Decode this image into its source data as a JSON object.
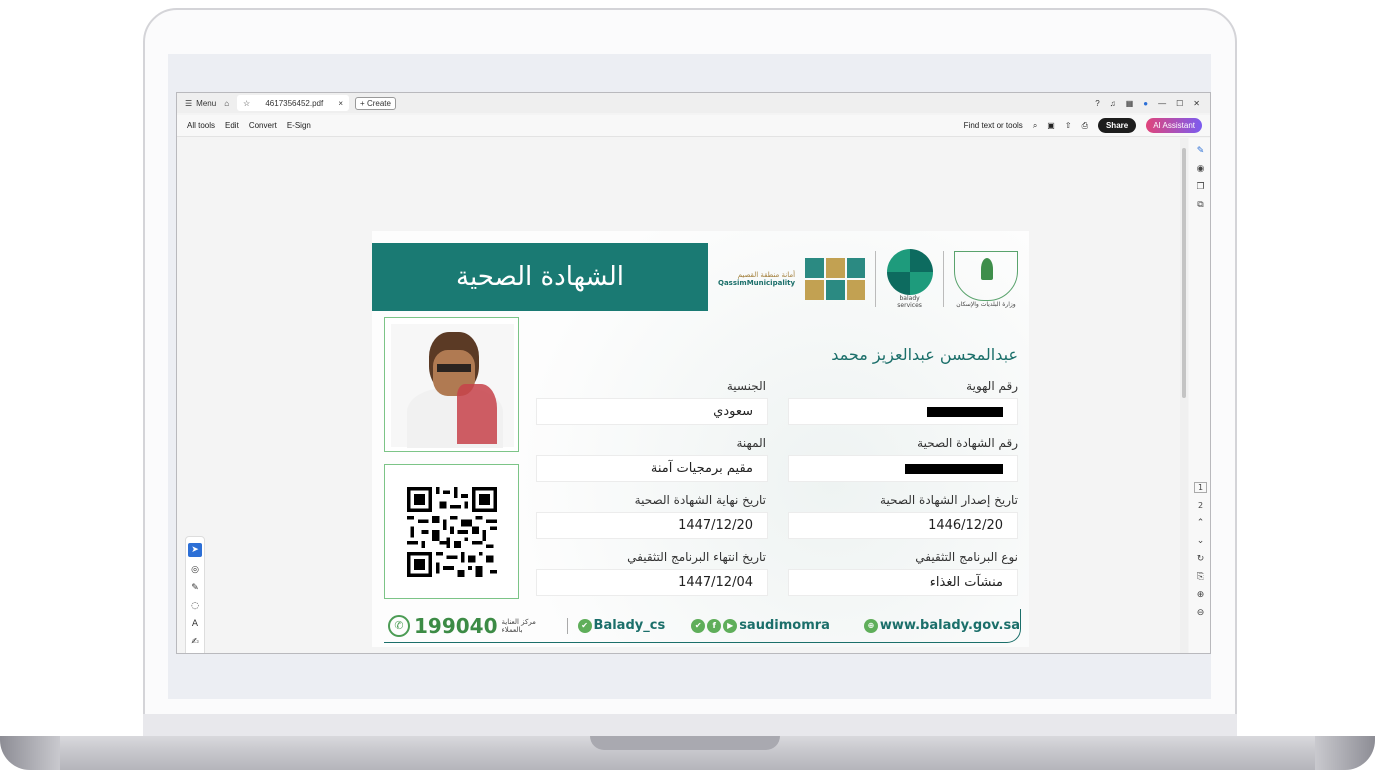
{
  "titlebar": {
    "menu_label": "Menu",
    "tab_title": "4617356452.pdf",
    "create_label": "Create",
    "close_tab": "×",
    "minimize": "—",
    "maximize": "☐",
    "close": "✕"
  },
  "menubar": {
    "items": [
      "All tools",
      "Edit",
      "Convert",
      "E-Sign"
    ],
    "search_label": "Find text or tools",
    "share_label": "Share",
    "ai_label": "AI Assistant"
  },
  "pager": {
    "current": "1",
    "next": "2"
  },
  "certificate": {
    "title": "الشهادة الصحية",
    "logo_qassim_ar": "أمانة منطقة القصيم",
    "logo_qassim_en": "QassimMunicipality",
    "balady_label": "balady",
    "balady_sub": "services",
    "ministry_label": "وزارة البلديات والإسكان",
    "name": "عبدالمحسن عبدالعزيز محمد",
    "labels": {
      "id_number": "رقم الهوية",
      "nationality": "الجنسية",
      "certificate_number": "رقم الشهادة الصحية",
      "profession": "المهنة",
      "issue_date": "تاريخ إصدار الشهادة الصحية",
      "expiry_date": "تاريخ نهاية الشهادة الصحية",
      "program_type": "نوع البرنامج التثقيفي",
      "program_end": "تاريخ انتهاء البرنامج التثقيفي"
    },
    "values": {
      "nationality": "سعودي",
      "profession": "مقيم برمجيات آمنة",
      "issue_date": "1446/12/20",
      "expiry_date": "1447/12/20",
      "program_type": "منشآت الغذاء",
      "program_end": "1447/12/04"
    },
    "footer": {
      "phone": "199040",
      "care_center": "مركز العناية بالعملاء",
      "twitter": "Balady_cs",
      "social": "saudimomra",
      "website": "www.balady.gov.sa"
    }
  },
  "colors": {
    "banner": "#1a7a73",
    "accent_green": "#4c9c55",
    "ai_gradient_start": "#e0457b",
    "ai_gradient_end": "#7b5cf0"
  }
}
